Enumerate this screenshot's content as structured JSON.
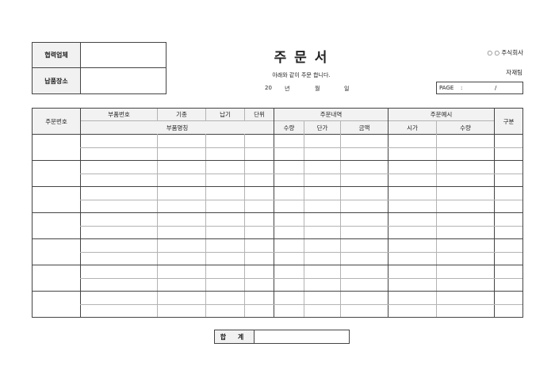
{
  "info": {
    "supplier_label": "협력업체",
    "supplier_value": "",
    "delivery_label": "납품장소",
    "delivery_value": ""
  },
  "header": {
    "title": "주 문 서",
    "subtitle": "아래와 같이 주문 합니다.",
    "date_year_prefix": "20",
    "date_year": "년",
    "date_month": "월",
    "date_day": "일",
    "company": "○ ○ 주식회사",
    "team": "자재팀",
    "page_label": "PAGE",
    "page_colon": ":",
    "page_slash": "/"
  },
  "table": {
    "headers": {
      "order_no": "주문번호",
      "part_no": "부품번호",
      "model": "기종",
      "delivery": "납기",
      "unit": "단위",
      "order_details": "주문내역",
      "order_note": "주문예시",
      "category": "구분",
      "part_name": "부품명칭",
      "qty": "수량",
      "unit_price": "단가",
      "amount": "금액",
      "time": "시가",
      "qty2": "수량"
    },
    "order_group_count": 7,
    "rows_per_group": 2
  },
  "total": {
    "label": "합 계",
    "value": ""
  }
}
